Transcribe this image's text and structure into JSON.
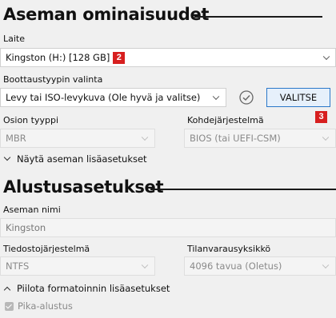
{
  "drive_properties": {
    "title": "Aseman ominaisuudet",
    "device_label": "Laite",
    "device_value": "Kingston (H:) [128 GB]",
    "device_badge": "2",
    "boot_label": "Boottaustyypin valinta",
    "boot_value": "Levy tai ISO-levykuva (Ole hyvä ja valitse)",
    "select_button": "VALITSE",
    "select_badge": "3",
    "partition_label": "Osion tyyppi",
    "partition_value": "MBR",
    "target_label": "Kohdejärjestelmä",
    "target_value": "BIOS (tai UEFI-CSM)",
    "advanced_toggle": "Näytä aseman lisäasetukset"
  },
  "format_options": {
    "title": "Alustusasetukset",
    "volume_label": "Aseman nimi",
    "volume_value": "Kingston",
    "fs_label": "Tiedostojärjestelmä",
    "fs_value": "NTFS",
    "cluster_label": "Tilanvarausyksikkö",
    "cluster_value": "4096 tavua (Oletus)",
    "advanced_toggle": "Piilota formatoinnin lisäasetukset",
    "quick_format_label": "Pika-alustus",
    "quick_format_checked": true
  },
  "colors": {
    "badge": "#d71f1f",
    "button_border": "#2a77c9"
  }
}
